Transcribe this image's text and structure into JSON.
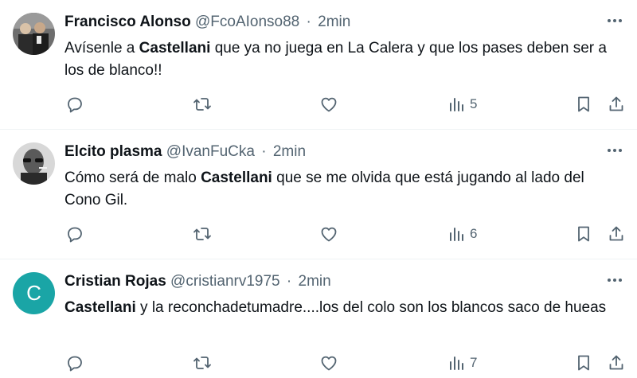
{
  "tweets": [
    {
      "name": "Francisco Alonso",
      "handle": "@FcoAIonso88",
      "separator": "·",
      "time": "2min",
      "text_bold": "Castellani",
      "text_before": "Avísenle a ",
      "text_after": " que ya no juega en La Calera y que los pases deben ser a los de blanco!!",
      "views": "5"
    },
    {
      "name": "Elcito plasma",
      "handle": "@IvanFuCka",
      "separator": "·",
      "time": "2min",
      "text_before": "Cómo será de malo ",
      "text_bold": "Castellani",
      "text_after": " que se me olvida que está jugando al lado del Cono Gil.",
      "views": "6"
    },
    {
      "name": "Cristian Rojas",
      "handle": "@cristianrv1975",
      "separator": "·",
      "time": "2min",
      "avatar_letter": "C",
      "text_before": "",
      "text_bold": "Castellani",
      "text_after": " y la reconchadetumadre....los del colo son los blancos saco de hueas",
      "views": "7"
    }
  ],
  "icons": {
    "reply": "reply-icon",
    "retweet": "retweet-icon",
    "like": "like-icon",
    "views": "views-icon",
    "bookmark": "bookmark-icon",
    "share": "share-icon",
    "more": "more-icon"
  },
  "colors": {
    "text": "#0f1419",
    "secondary": "#536471",
    "divider": "#eff3f4",
    "avatar_c": "#1aa5a6"
  }
}
